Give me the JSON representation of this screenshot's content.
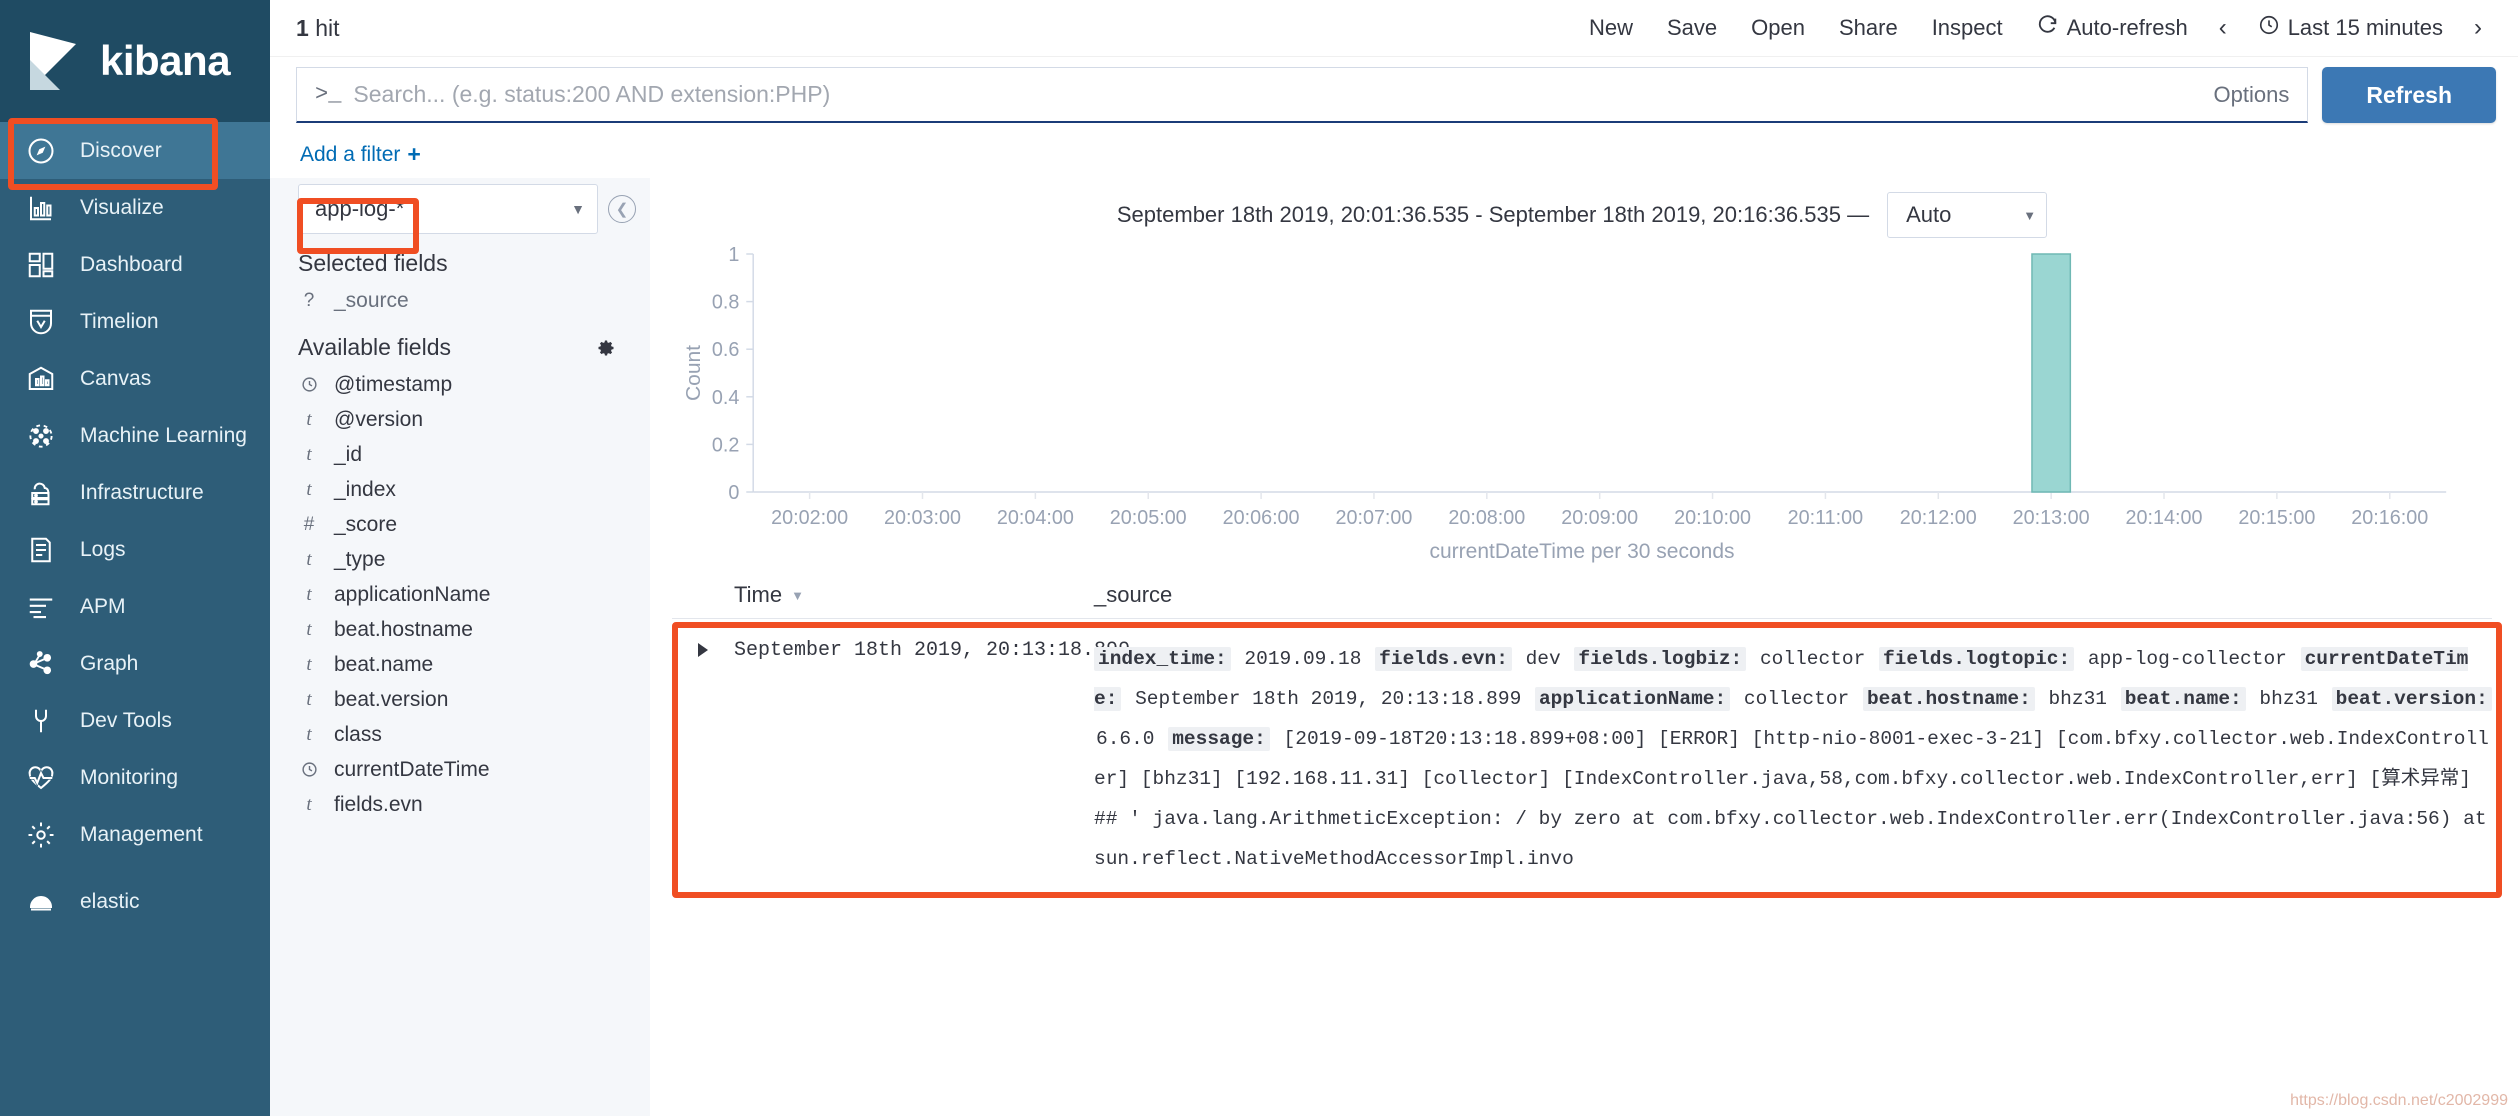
{
  "brand": {
    "name": "kibana"
  },
  "sidebar": {
    "items": [
      {
        "label": "Discover",
        "icon": "compass-icon",
        "active": true
      },
      {
        "label": "Visualize",
        "icon": "bar-chart-icon",
        "active": false
      },
      {
        "label": "Dashboard",
        "icon": "dashboard-icon",
        "active": false
      },
      {
        "label": "Timelion",
        "icon": "timelion-icon",
        "active": false
      },
      {
        "label": "Canvas",
        "icon": "canvas-icon",
        "active": false
      },
      {
        "label": "Machine Learning",
        "icon": "machine-learning-icon",
        "active": false
      },
      {
        "label": "Infrastructure",
        "icon": "infrastructure-icon",
        "active": false
      },
      {
        "label": "Logs",
        "icon": "logs-icon",
        "active": false
      },
      {
        "label": "APM",
        "icon": "apm-icon",
        "active": false
      },
      {
        "label": "Graph",
        "icon": "graph-icon",
        "active": false
      },
      {
        "label": "Dev Tools",
        "icon": "wrench-icon",
        "active": false
      },
      {
        "label": "Monitoring",
        "icon": "heartbeat-icon",
        "active": false
      },
      {
        "label": "Management",
        "icon": "gear-icon",
        "active": false
      },
      {
        "label": "elastic",
        "icon": "elastic-logo-icon",
        "active": false
      }
    ]
  },
  "topbar": {
    "hit_count": "1",
    "hit_label": "hit",
    "actions": [
      "New",
      "Save",
      "Open",
      "Share",
      "Inspect"
    ],
    "auto_refresh": "Auto-refresh",
    "time_picker": "Last 15 minutes",
    "prev_arrow": "‹",
    "next_arrow": "›"
  },
  "search": {
    "prompt": ">_",
    "value": "",
    "placeholder": "Search... (e.g. status:200 AND extension:PHP)",
    "options_label": "Options",
    "refresh_label": "Refresh"
  },
  "filters": {
    "add_filter_label": "Add a filter",
    "plus": "+"
  },
  "fieldpanel": {
    "index_pattern": "app-log-*",
    "selected_fields_label": "Selected fields",
    "available_fields_label": "Available fields",
    "selected_fields": [
      {
        "type": "?",
        "name": "_source"
      }
    ],
    "available_fields": [
      {
        "type": "clock",
        "name": "@timestamp"
      },
      {
        "type": "t",
        "name": "@version"
      },
      {
        "type": "t",
        "name": "_id"
      },
      {
        "type": "t",
        "name": "_index"
      },
      {
        "type": "#",
        "name": "_score"
      },
      {
        "type": "t",
        "name": "_type"
      },
      {
        "type": "t",
        "name": "applicationName"
      },
      {
        "type": "t",
        "name": "beat.hostname"
      },
      {
        "type": "t",
        "name": "beat.name"
      },
      {
        "type": "t",
        "name": "beat.version"
      },
      {
        "type": "t",
        "name": "class"
      },
      {
        "type": "clock",
        "name": "currentDateTime"
      },
      {
        "type": "t",
        "name": "fields.evn"
      }
    ]
  },
  "chart_header": {
    "time_range": "September 18th 2019, 20:01:36.535 - September 18th 2019, 20:16:36.535 —",
    "interval": "Auto"
  },
  "chart_data": {
    "type": "bar",
    "title": "",
    "xlabel": "currentDateTime per 30 seconds",
    "ylabel": "Count",
    "ylim": [
      0,
      1
    ],
    "ytick_labels": [
      "0",
      "0.2",
      "0.4",
      "0.6",
      "0.8",
      "1"
    ],
    "ytick_values": [
      0,
      0.2,
      0.4,
      0.6,
      0.8,
      1
    ],
    "categories": [
      "20:02:00",
      "20:03:00",
      "20:04:00",
      "20:05:00",
      "20:06:00",
      "20:07:00",
      "20:08:00",
      "20:09:00",
      "20:10:00",
      "20:11:00",
      "20:12:00",
      "20:13:00",
      "20:14:00",
      "20:15:00",
      "20:16:00"
    ],
    "values": [
      0,
      0,
      0,
      0,
      0,
      0,
      0,
      0,
      0,
      0,
      0,
      1,
      0,
      0,
      0
    ],
    "bar_color": "#9ad6d2",
    "bar_border_color": "#6fb8b4",
    "grid": false,
    "legend": "none"
  },
  "doc_table": {
    "columns": [
      "Time",
      "_source"
    ],
    "sort_caret": "▼",
    "rows": [
      {
        "time": "September 18th 2019, 20:13:18.899",
        "source_pairs": [
          {
            "key": "index_time:",
            "value": "2019.09.18"
          },
          {
            "key": "fields.evn:",
            "value": "dev"
          },
          {
            "key": "fields.logbiz:",
            "value": "collector"
          },
          {
            "key": "fields.logtopic:",
            "value": "app-log-collector"
          },
          {
            "key": "currentDateTime:",
            "value": "September 18th 2019, 20:13:18.899"
          },
          {
            "key": "applicationName:",
            "value": "collector"
          },
          {
            "key": "beat.hostname:",
            "value": "bhz31"
          },
          {
            "key": "beat.name:",
            "value": "bhz31"
          },
          {
            "key": "beat.version:",
            "value": "6.6.0"
          },
          {
            "key": "message:",
            "value": "[2019-09-18T20:13:18.899+08:00] [ERROR] [http-nio-8001-exec-3-21] [com.bfxy.collector.web.IndexController] [bhz31] [192.168.11.31] [collector] [IndexController.java,58,com.bfxy.collector.web.IndexController,err] [算术异常] ## ' java.lang.ArithmeticException: / by zero at com.bfxy.collector.web.IndexController.err(IndexController.java:56) at sun.reflect.NativeMethodAccessorImpl.invo"
          }
        ]
      }
    ]
  },
  "watermark": "https://blog.csdn.net/c2002999"
}
